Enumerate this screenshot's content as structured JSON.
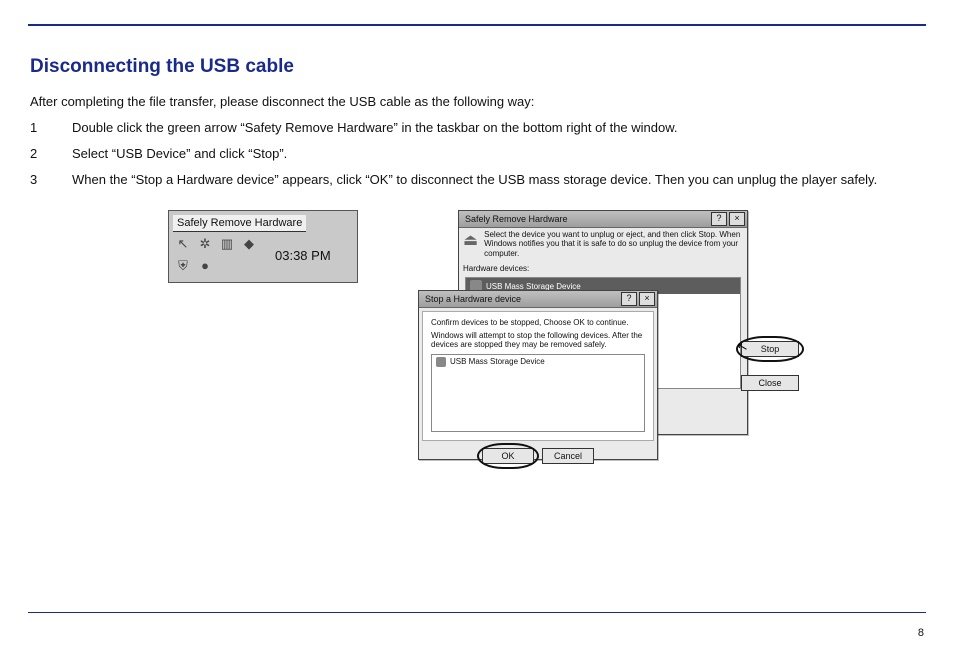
{
  "heading": "Disconnecting the USB cable",
  "intro": "After completing the file transfer, please disconnect the USB cable as the following way:",
  "steps": [
    {
      "n": "1",
      "text": "Double click the green arrow “Safety Remove Hardware” in the taskbar on the bottom right of the window."
    },
    {
      "n": "2",
      "text": "Select “USB Device” and click “Stop”."
    },
    {
      "n": "3",
      "text": "When the “Stop a Hardware device” appears, click “OK” to disconnect the USB mass storage device. Then you can unplug the player safely."
    }
  ],
  "tray": {
    "tooltip": "Safely Remove Hardware",
    "clock": "03:38 PM",
    "icons": [
      "cursor-icon",
      "gear-icon",
      "monitor-icon",
      "app-icon",
      "shield-icon",
      "dot-icon",
      "blank",
      "blank"
    ]
  },
  "dialogA": {
    "title": "Safely Remove Hardware",
    "help_btn": "?",
    "close_btn": "×",
    "message": "Select the device you want to unplug or eject, and then click Stop. When Windows notifies you that it is safe to do so unplug the device from your computer.",
    "hw_label": "Hardware devices:",
    "selected_item": "USB Mass Storage Device",
    "stop_btn": "Stop",
    "close_btn_label": "Close"
  },
  "dialogB": {
    "title": "Stop a Hardware device",
    "help_btn": "?",
    "close_btn": "×",
    "msg1": "Confirm devices to be stopped, Choose OK to continue.",
    "msg2": "Windows will attempt to stop the following devices. After the devices are stopped they may be removed safely.",
    "device": "USB Mass Storage Device",
    "ok_btn": "OK",
    "cancel_btn": "Cancel"
  },
  "page_number": "8"
}
